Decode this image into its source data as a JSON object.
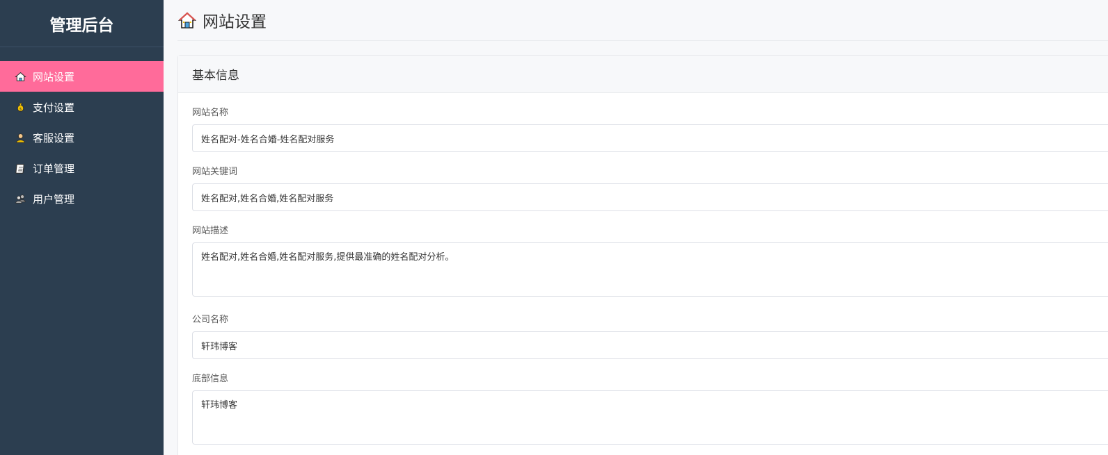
{
  "sidebar": {
    "brand": "管理后台",
    "items": [
      {
        "label": "网站设置",
        "icon": "house-icon",
        "active": true
      },
      {
        "label": "支付设置",
        "icon": "money-bag-icon",
        "active": false
      },
      {
        "label": "客服设置",
        "icon": "support-agent-icon",
        "active": false
      },
      {
        "label": "订单管理",
        "icon": "clipboard-icon",
        "active": false
      },
      {
        "label": "用户管理",
        "icon": "users-icon",
        "active": false
      }
    ],
    "active_color": "#ff6b9a",
    "bg_color": "#2c3e50"
  },
  "header": {
    "title": "网站设置",
    "icon": "house-icon"
  },
  "card": {
    "title": "基本信息",
    "fields": [
      {
        "label": "网站名称",
        "type": "input",
        "value": "姓名配对-姓名合婚-姓名配对服务"
      },
      {
        "label": "网站关键词",
        "type": "input",
        "value": "姓名配对,姓名合婚,姓名配对服务"
      },
      {
        "label": "网站描述",
        "type": "textarea",
        "value": "姓名配对,姓名合婚,姓名配对服务,提供最准确的姓名配对分析。"
      },
      {
        "label": "公司名称",
        "type": "input",
        "value": "轩玮博客"
      },
      {
        "label": "底部信息",
        "type": "textarea",
        "value": "轩玮博客"
      }
    ]
  }
}
